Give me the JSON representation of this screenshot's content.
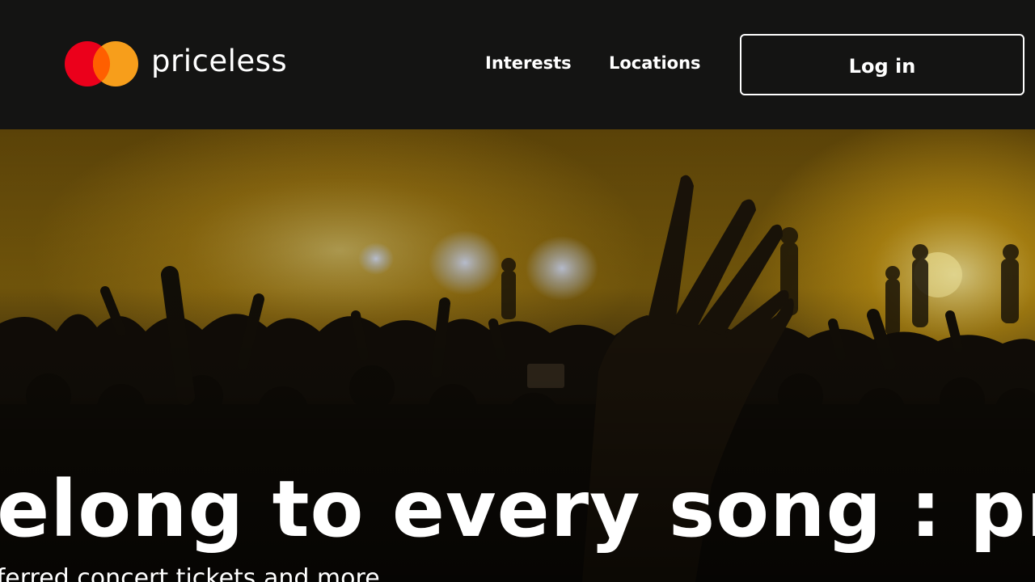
{
  "brand": {
    "name": "priceless",
    "logo_colors": {
      "left_circle": "#eb001b",
      "right_circle": "#f79e1b",
      "overlap": "#ff5f00"
    }
  },
  "nav": {
    "items": [
      {
        "label": "Interests"
      },
      {
        "label": "Locations"
      }
    ],
    "login_label": "Log in"
  },
  "hero": {
    "title": "Belong to every song :  priceless",
    "subtitle": "Preferred concert tickets and more",
    "image": "concert-crowd-with-raised-hands",
    "accent_color": "#e6a512"
  },
  "colors": {
    "header_bg": "#141413",
    "text": "#ffffff"
  }
}
